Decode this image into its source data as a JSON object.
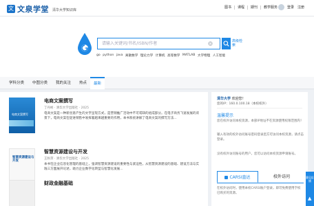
{
  "header": {
    "logo_badge": "文",
    "logo_text": "文泉学堂",
    "logo_sub": "清华大学知识库",
    "nav": [
      "图书",
      "课程",
      "期刊",
      "教学服务"
    ],
    "user_name": "登录",
    "user_action": "注册"
  },
  "search": {
    "placeholder": "请输入关键词/书名/ISBN/作者",
    "advanced_label": "高级检索",
    "hot_words": [
      "go",
      "python",
      "java",
      "离散数学",
      "理论力学",
      "计算机",
      "高等数学",
      "MATLAB",
      "大学物理",
      "人工智能"
    ]
  },
  "tabs": [
    {
      "label": "学科分类"
    },
    {
      "label": "中图分类"
    },
    {
      "label": "我的关注"
    },
    {
      "label": "热点"
    },
    {
      "label": "最新"
    }
  ],
  "books": [
    {
      "cover_title": "电商文案撰写",
      "title": "电商文案撰写",
      "meta": "丁丹彬 · 清华大学出版社 · 2025",
      "desc": "电商文案是一种新创意产生的文字呈现方式，是营销推广活动中不可或缺的组成部分。在电子商务飞速发展的背景下，电商文案在促进销售中发挥着越来越重要的作用，本书系统讲解了电商文案的撰写方法..."
    },
    {
      "cover_title": "智慧资源建设与开发",
      "title": "智慧资源建设与开发",
      "meta": "王秋萍 · 清华大学出版社 · 2025",
      "desc": "本书在企业信息化管理的基础上，强调智慧资源建设的重要性与紧迫性，从智慧资源建设的基础、建设方法与实践三方面展开论述，助力企业数字化转型与智慧化发展..."
    },
    {
      "cover_title": "财政金融基础",
      "title": "财政金融基础",
      "meta": "",
      "desc": ""
    }
  ],
  "sidebar": {
    "org": "清华大学",
    "welcome": "欢迎您！",
    "ip_label": "您的IP：",
    "ip_value": "160.0.100.18（本校校外）",
    "warm_title": "温馨提示",
    "tip1": "您在校外访问本校资源，本部IP地址不在资源使用权限范围内！",
    "tip2": "输入有效的校外访问账号密码登录后方可访问本校资源，请点击登录。",
    "tip3": "没有校外访问账号的用户，您可以访问本校资源申请账号。",
    "tab_carsi": "CARSI直达",
    "tab_campus": "校外访问",
    "carsi_text": "在校外访问时，使用本校CARSI账户登录，即可免费使用学校已购买的资源。"
  },
  "floater": {
    "label": "意见反馈"
  }
}
